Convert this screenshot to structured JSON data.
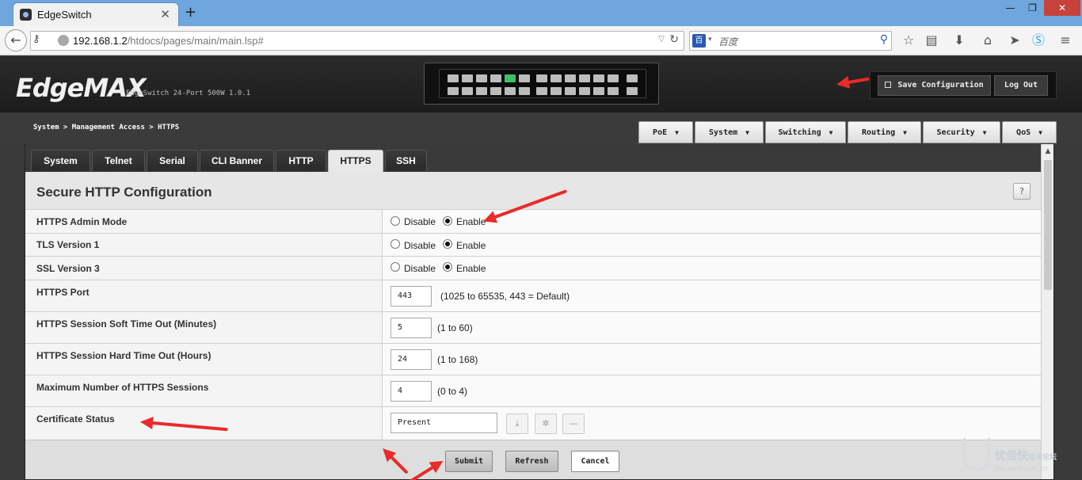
{
  "browser": {
    "tab_title": "EdgeSwitch",
    "url_host": "192.168.1.2",
    "url_path": "/htdocs/pages/main/main.lsp#",
    "search_placeholder": "百度"
  },
  "header": {
    "logo": "EdgeMAX",
    "logo_tm": "™",
    "model": "EdgeSwitch 24-Port 500W 1.0.1",
    "save_label": "Save Configuration",
    "logout_label": "Log Out",
    "active_port": 5
  },
  "breadcrumb": "System > Management Access > HTTPS",
  "menu": [
    "PoE",
    "System",
    "Switching",
    "Routing",
    "Security",
    "QoS"
  ],
  "tabs": [
    "System",
    "Telnet",
    "Serial",
    "CLI Banner",
    "HTTP",
    "HTTPS",
    "SSH"
  ],
  "active_tab": "HTTPS",
  "section_title": "Secure HTTP Configuration",
  "help_label": "?",
  "radio_labels": {
    "disable": "Disable",
    "enable": "Enable"
  },
  "rows": {
    "admin_mode": {
      "label": "HTTPS Admin Mode",
      "value": "Enable"
    },
    "tls": {
      "label": "TLS Version 1",
      "value": "Enable"
    },
    "ssl": {
      "label": "SSL Version 3",
      "value": "Enable"
    },
    "port": {
      "label": "HTTPS Port",
      "value": "443",
      "hint": "(1025 to 65535, 443 = Default)"
    },
    "soft_timeout": {
      "label": "HTTPS Session Soft Time Out  (Minutes)",
      "value": "5",
      "hint": "(1 to 60)"
    },
    "hard_timeout": {
      "label": "HTTPS Session Hard Time Out  (Hours)",
      "value": "24",
      "hint": "(1 to 168)"
    },
    "max_sessions": {
      "label": "Maximum Number of HTTPS Sessions",
      "value": "4",
      "hint": "(0 to 4)"
    },
    "cert_status": {
      "label": "Certificate Status",
      "value": "Present"
    }
  },
  "buttons": {
    "submit": "Submit",
    "refresh": "Refresh",
    "cancel": "Cancel"
  },
  "watermark": {
    "text": "优倍快",
    "sub_text": "技术论坛",
    "domain": "bbs.ubnt.com.cn"
  }
}
